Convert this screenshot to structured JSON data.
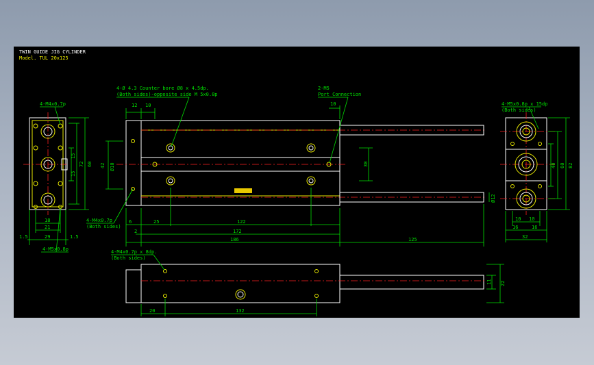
{
  "title_block": {
    "title": "TWIN GUIDE JIG CYLINDER",
    "model": "Model. TUL 20x125"
  },
  "notes": {
    "front_tl": "4-M4x0.7p",
    "front_bl": "4-M5x0.8p",
    "top_holes": "4-Ø 4.3 Counter bore Ø8 x 4.5dp.",
    "top_holes_sub": "(Both sides)-opposite side M 5x0.8p",
    "port": "2-M5",
    "port_sub": "Port Connection",
    "body_left": "4-M4x0.7p",
    "both_sides": "(Both sides)",
    "right_top": "4-M5x0.8p x 15dp",
    "right_top_sub": "(Both sides)",
    "bottom_holes": "4-M4x0.7p x 8dp.",
    "bottom_holes_sub": "(Both sides)"
  },
  "dims": {
    "front": [
      "60",
      "72",
      "15",
      "15",
      "18",
      "21",
      "29",
      "1.5",
      "1.5"
    ],
    "top": [
      "12",
      "10",
      "10",
      "42",
      "Ø10",
      "30",
      "6",
      "2",
      "25",
      "122",
      "172",
      "186",
      "125",
      "Ø12"
    ],
    "side": [
      "40",
      "60",
      "82",
      "10",
      "10",
      "16",
      "16",
      "32"
    ],
    "bottom": [
      "11",
      "22",
      "20",
      "132"
    ]
  },
  "colors": {
    "background": "#000000",
    "outline": "#ffffff",
    "hidden": "#e8e800",
    "dimension": "#00e000",
    "center_line": "#ff2020",
    "logo": "#e8c800"
  }
}
